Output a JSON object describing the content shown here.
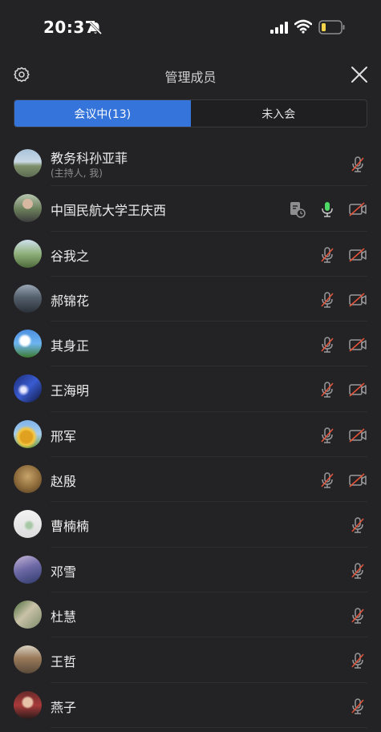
{
  "status_bar": {
    "time": "20:37"
  },
  "header": {
    "title": "管理成员"
  },
  "tabs": [
    {
      "label": "会议中(13)",
      "active": true
    },
    {
      "label": "未入会",
      "active": false
    }
  ],
  "members": [
    {
      "name": "教务科孙亚菲",
      "sub": "(主持人, 我)"
    },
    {
      "name": "中国民航大学王庆西"
    },
    {
      "name": "谷我之"
    },
    {
      "name": "郝锦花"
    },
    {
      "name": "其身正"
    },
    {
      "name": "王海明"
    },
    {
      "name": "邢军"
    },
    {
      "name": "赵殷"
    },
    {
      "name": "曹楠楠"
    },
    {
      "name": "邓雪"
    },
    {
      "name": "杜慧"
    },
    {
      "name": "王哲"
    },
    {
      "name": "燕子"
    }
  ],
  "colors": {
    "accent": "#3574db",
    "mic_active": "#4cd964",
    "mute_red": "#e0533a"
  }
}
